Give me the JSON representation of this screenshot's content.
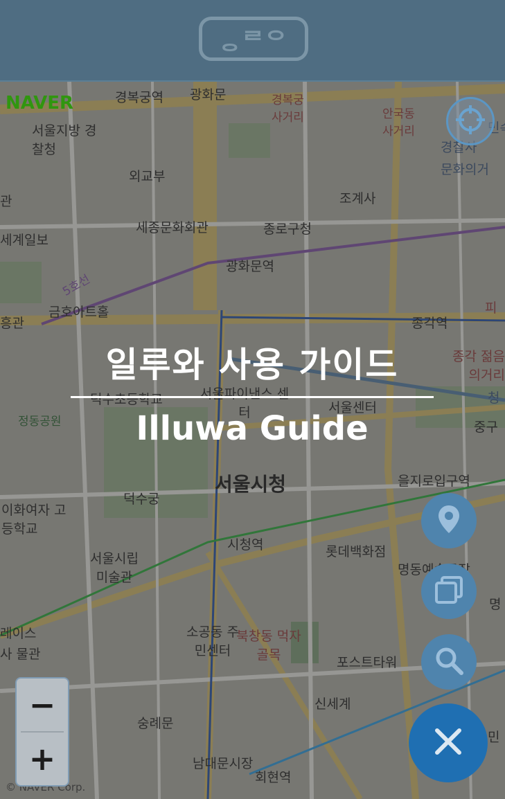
{
  "header": {
    "logo_text": "ᆼᄅᄋ"
  },
  "map": {
    "provider_logo": "NAVER",
    "attribution": "© NAVER Corp.",
    "labels": [
      "경복궁역",
      "광화문",
      "경복궁 사거리",
      "안국동 사거리",
      "서울지방 경찰청",
      "외교부",
      "조계사",
      "세종문화회관",
      "종로구청",
      "광화문역",
      "금호아트홀",
      "종각역",
      "세계일보",
      "덕수초등학교",
      "서울파이낸스 센터",
      "서울센터",
      "정동공원",
      "서울시청",
      "을지로입구역",
      "덕수궁",
      "이화여자 고등학교",
      "시청역",
      "롯데백화점",
      "서울시립 미술관",
      "명동예술극장",
      "소공동 주민센터",
      "북창동 먹자골목",
      "포스트타워",
      "신세계",
      "숭례문",
      "남대문시장",
      "회현역",
      "중구",
      "종각 젊음의거리",
      "5호선",
      "피",
      "청",
      "문화의거",
      "경찰사",
      "명",
      "민",
      "레이스",
      "관",
      "흥관",
      "사 물관",
      "민속"
    ]
  },
  "guide": {
    "title_korean": "일루와 사용 가이드",
    "title_english": "Illuwa Guide"
  },
  "controls": {
    "locate_icon": "crosshair-icon",
    "zoom_out_label": "−",
    "zoom_in_label": "+",
    "marker_icon": "map-pin-icon",
    "layers_icon": "layers-icon",
    "search_icon": "search-icon",
    "close_icon": "close-icon"
  },
  "colors": {
    "header": "#4f6d82",
    "fab_light": "#5b96c4",
    "fab_dark": "#1f6fb2"
  }
}
